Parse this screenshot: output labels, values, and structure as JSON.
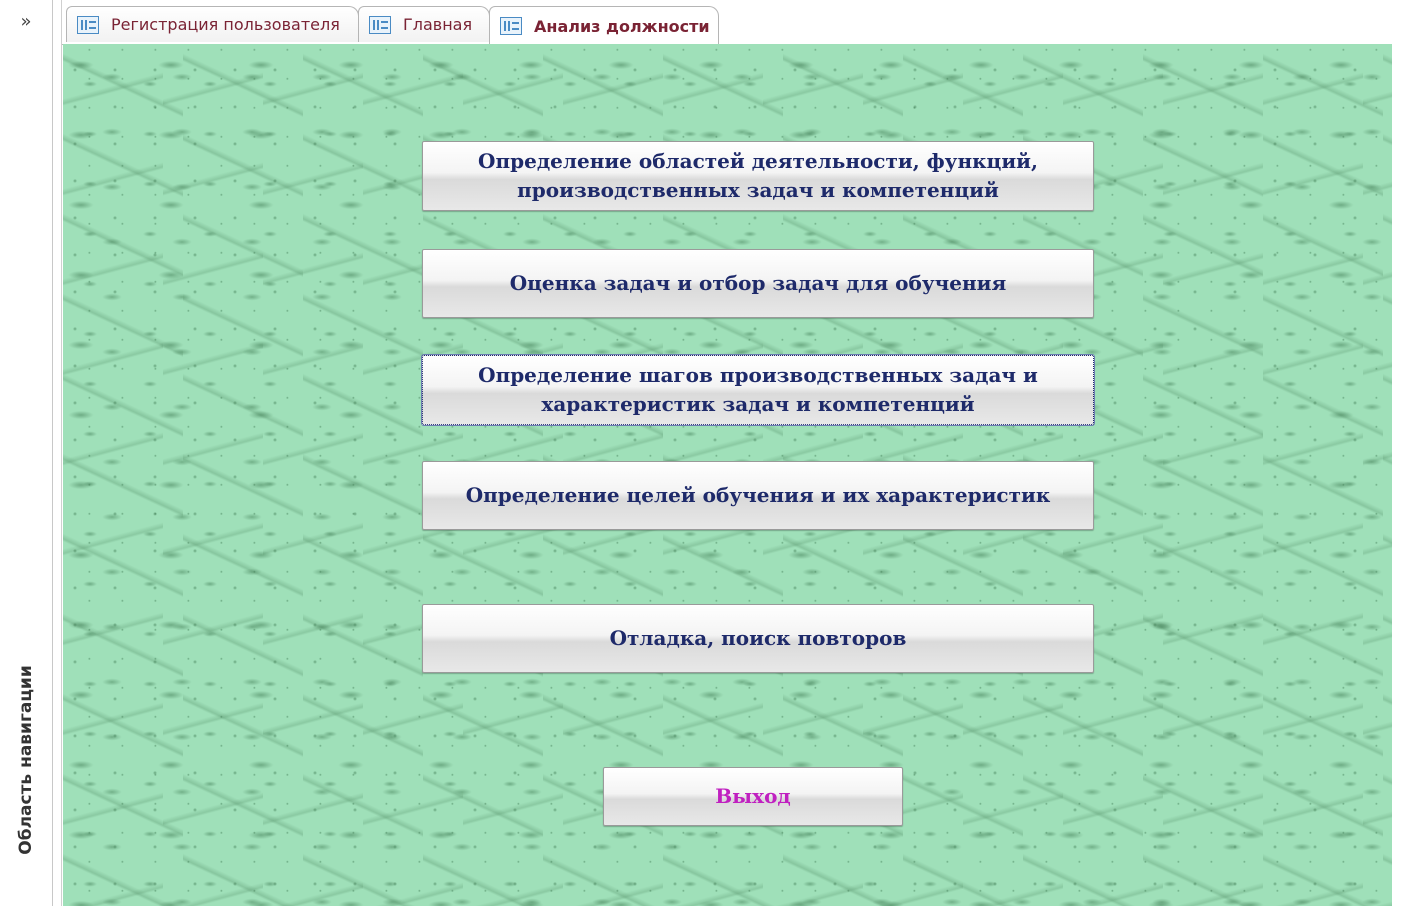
{
  "nav": {
    "toggle_label": "»",
    "pane_label": "Область навигации"
  },
  "tabs": [
    {
      "label": "Регистрация пользователя",
      "active": false
    },
    {
      "label": "Главная",
      "active": false
    },
    {
      "label": "Анализ должности",
      "active": true
    }
  ],
  "form": {
    "buttons": [
      {
        "label": "Определение областей деятельности, функций, производственных задач и компетенций"
      },
      {
        "label": "Оценка задач и отбор задач для обучения"
      },
      {
        "label": "Определение шагов производственных задач и характеристик задач и компетенций"
      },
      {
        "label": "Определение целей обучения и их характеристик"
      },
      {
        "label": "Отладка, поиск повторов"
      }
    ],
    "exit_label": "Выход"
  },
  "colors": {
    "background": "#9fe0b9",
    "button_text": "#1e2a6a",
    "exit_text": "#c020c0",
    "tab_text": "#7a2334"
  }
}
